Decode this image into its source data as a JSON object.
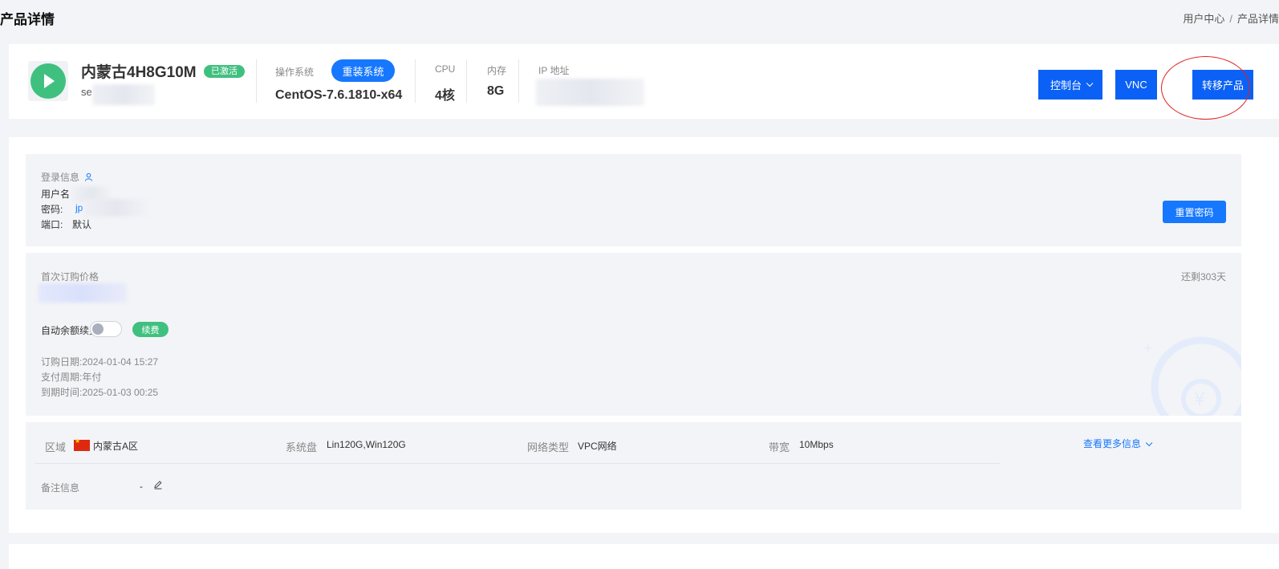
{
  "page": {
    "title": "产品详情"
  },
  "breadcrumb": {
    "home": "用户中心",
    "separator": "/",
    "current": "产品详情"
  },
  "product": {
    "name": "内蒙古4H8G10M",
    "status": "已激活",
    "sub_prefix": "se",
    "os_label": "操作系统",
    "os_value": "CentOS-7.6.1810-x64",
    "reinstall_label": "重装系统",
    "cpu_label": "CPU",
    "cpu_value": "4核",
    "mem_label": "内存",
    "mem_value": "8G",
    "ip_label": "IP 地址"
  },
  "actions": {
    "console_label": "控制台",
    "vnc_label": "VNC",
    "transfer_label": "转移产品"
  },
  "login": {
    "title": "登录信息",
    "username_label": "用户名",
    "password_label": "密码:",
    "password_value_visible": "jp",
    "port_label": "端口:",
    "port_value": "默认",
    "reset_label": "重置密码"
  },
  "billing": {
    "first_price_label": "首次订购价格",
    "remaining": "还剩303天",
    "auto_renew_label": "自动余额续费",
    "auto_renew_on": false,
    "renew_label": "续费",
    "order_date_label": "订购日期:",
    "order_date": "2024-01-04 15:27",
    "cycle_label": "支付周期:",
    "cycle": "年付",
    "expire_label": "到期时间:",
    "expire": "2025-01-03 00:25"
  },
  "details": {
    "region_label": "区域",
    "region_value": "内蒙古A区",
    "disk_label": "系统盘",
    "disk_value": "Lin120G,Win120G",
    "network_label": "网络类型",
    "network_value": "VPC网络",
    "bandwidth_label": "带宽",
    "bandwidth_value": "10Mbps",
    "more_label": "查看更多信息",
    "remark_label": "备注信息",
    "remark_value": "-"
  },
  "colors": {
    "primary": "#1677ff",
    "action_blue": "#0b61f5",
    "success": "#40c07f",
    "highlight": "#e02020"
  }
}
